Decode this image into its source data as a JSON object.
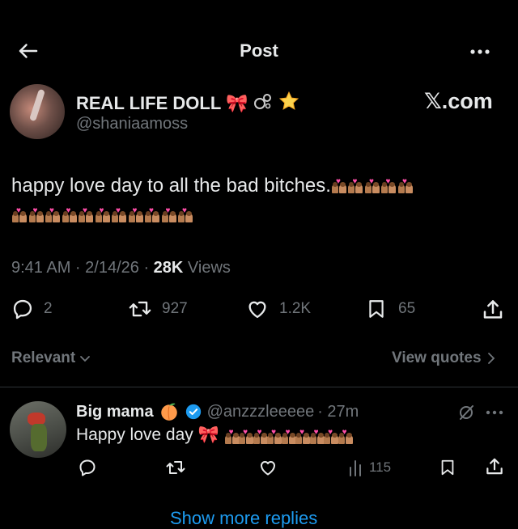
{
  "header": {
    "title": "Post"
  },
  "author": {
    "name": "REAL LIFE DOLL",
    "name_emojis": "🎀 ",
    "handle": "@shaniaamoss",
    "watermark": "𝕏.com"
  },
  "tweet": {
    "text": "happy love day to all the bad bitches.",
    "emoji_row1_count": 5,
    "emoji_row2_count": 11,
    "time": "9:41 AM · 2/14/26 · ",
    "views_count": "28K",
    "views_label": " Views"
  },
  "actions": {
    "replies": "2",
    "retweets": "927",
    "likes": "1.2K",
    "bookmarks": "65"
  },
  "filters": {
    "sort_label": "Relevant",
    "view_quotes": "View quotes"
  },
  "reply": {
    "name": "Big mama",
    "handle": "@anzzzleeeee",
    "time": "· 27m",
    "text": "Happy love day",
    "emoji_count": 9,
    "views": "115"
  },
  "more_replies": "Show more replies",
  "colors": {
    "accent": "#1d9bf0",
    "verified": "#1d9bf0",
    "text": "#e7e9ea",
    "muted": "#71767b"
  }
}
